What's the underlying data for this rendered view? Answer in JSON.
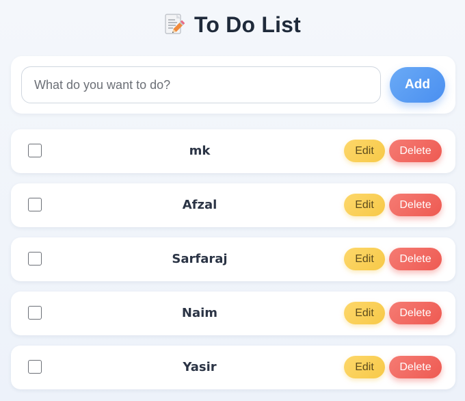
{
  "header": {
    "title": "To Do List",
    "icon": "memo-icon"
  },
  "input": {
    "placeholder": "What do you want to do?",
    "value": "",
    "add_label": "Add"
  },
  "todos": [
    {
      "text": "mk",
      "checked": false,
      "edit_label": "Edit",
      "delete_label": "Delete"
    },
    {
      "text": "Afzal",
      "checked": false,
      "edit_label": "Edit",
      "delete_label": "Delete"
    },
    {
      "text": "Sarfaraj",
      "checked": false,
      "edit_label": "Edit",
      "delete_label": "Delete"
    },
    {
      "text": "Naim",
      "checked": false,
      "edit_label": "Edit",
      "delete_label": "Delete"
    },
    {
      "text": "Yasir",
      "checked": false,
      "edit_label": "Edit",
      "delete_label": "Delete"
    }
  ],
  "colors": {
    "add_button": "#5a9cf3",
    "edit_button": "#fad25a",
    "delete_button": "#f16a62",
    "title": "#1f2a3a"
  }
}
